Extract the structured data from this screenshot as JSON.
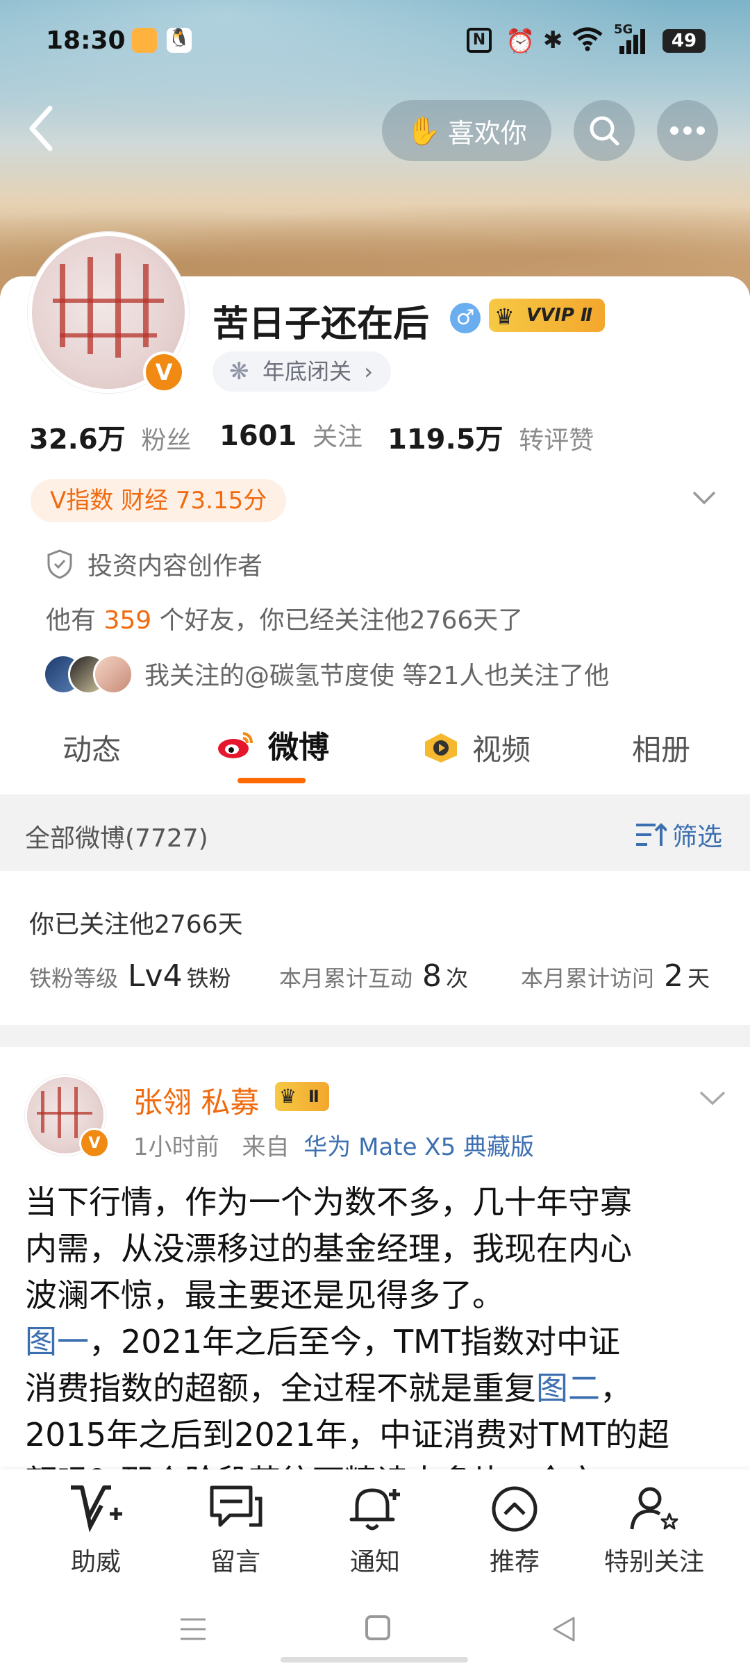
{
  "status_bar": {
    "time": "18:30",
    "network": "5G",
    "battery": "49"
  },
  "header": {
    "like_label": "喜欢你"
  },
  "profile": {
    "name": "苦日子还在后",
    "vip": "VVIP Ⅱ",
    "tag": "年底闭关",
    "stats": [
      {
        "value": "32.6万",
        "label": "粉丝"
      },
      {
        "value": "1601",
        "label": "关注"
      },
      {
        "value": "119.5万",
        "label": "转评赞"
      }
    ],
    "v_index": "V指数 财经 73.15分",
    "creator": "投资内容创作者",
    "friends_prefix": "他有",
    "friends_count": "359",
    "friends_suffix": "个好友，你已经关注他2766天了",
    "mutual": "我关注的@碳氢节度使 等21人也关注了他"
  },
  "tabs": [
    {
      "label": "动态",
      "active": false
    },
    {
      "label": "微博",
      "active": true
    },
    {
      "label": "视频",
      "active": false
    },
    {
      "label": "相册",
      "active": false
    }
  ],
  "filter": {
    "all_label": "全部微博(7727)",
    "filter_label": "筛选"
  },
  "fan_card": {
    "title": "你已关注他2766天",
    "level_label": "铁粉等级",
    "level_value": "Lv4",
    "level_suffix": "铁粉",
    "interact_label": "本月累计互动",
    "interact_value": "8",
    "interact_suffix": "次",
    "visit_label": "本月累计访问",
    "visit_value": "2",
    "visit_suffix": "天"
  },
  "post": {
    "author": "张翎 私募",
    "badge": "Ⅱ",
    "time": "1小时前",
    "from_label": "来自",
    "device": "华为 Mate X5 典藏版",
    "line1": "当下行情，作为一个为数不多，几十年守寡",
    "line2": "内需，从没漂移过的基金经理，我现在内心",
    "line3": "波澜不惊，最主要还是见得多了。",
    "line4_link": "图一",
    "line4": "，2021年之后至今，TMT指数对中证",
    "line5": "消费指数的超额，全过程不就是重复",
    "line5_link": "图二",
    "line5_end": "，",
    "line6": "2015年之后到2021年，中证消费对TMT的超",
    "line7": "额吗？那个阶段若往下精读太多片...全文"
  },
  "bottom_nav": [
    {
      "label": "助威",
      "icon": "cheer-icon"
    },
    {
      "label": "留言",
      "icon": "message-icon"
    },
    {
      "label": "通知",
      "icon": "bell-icon"
    },
    {
      "label": "推荐",
      "icon": "recommend-icon"
    },
    {
      "label": "特别关注",
      "icon": "special-follow-icon"
    }
  ],
  "colors": {
    "accent": "#f08a13",
    "link": "#3c6fb0",
    "tab_indicator": "#ff6a00"
  }
}
